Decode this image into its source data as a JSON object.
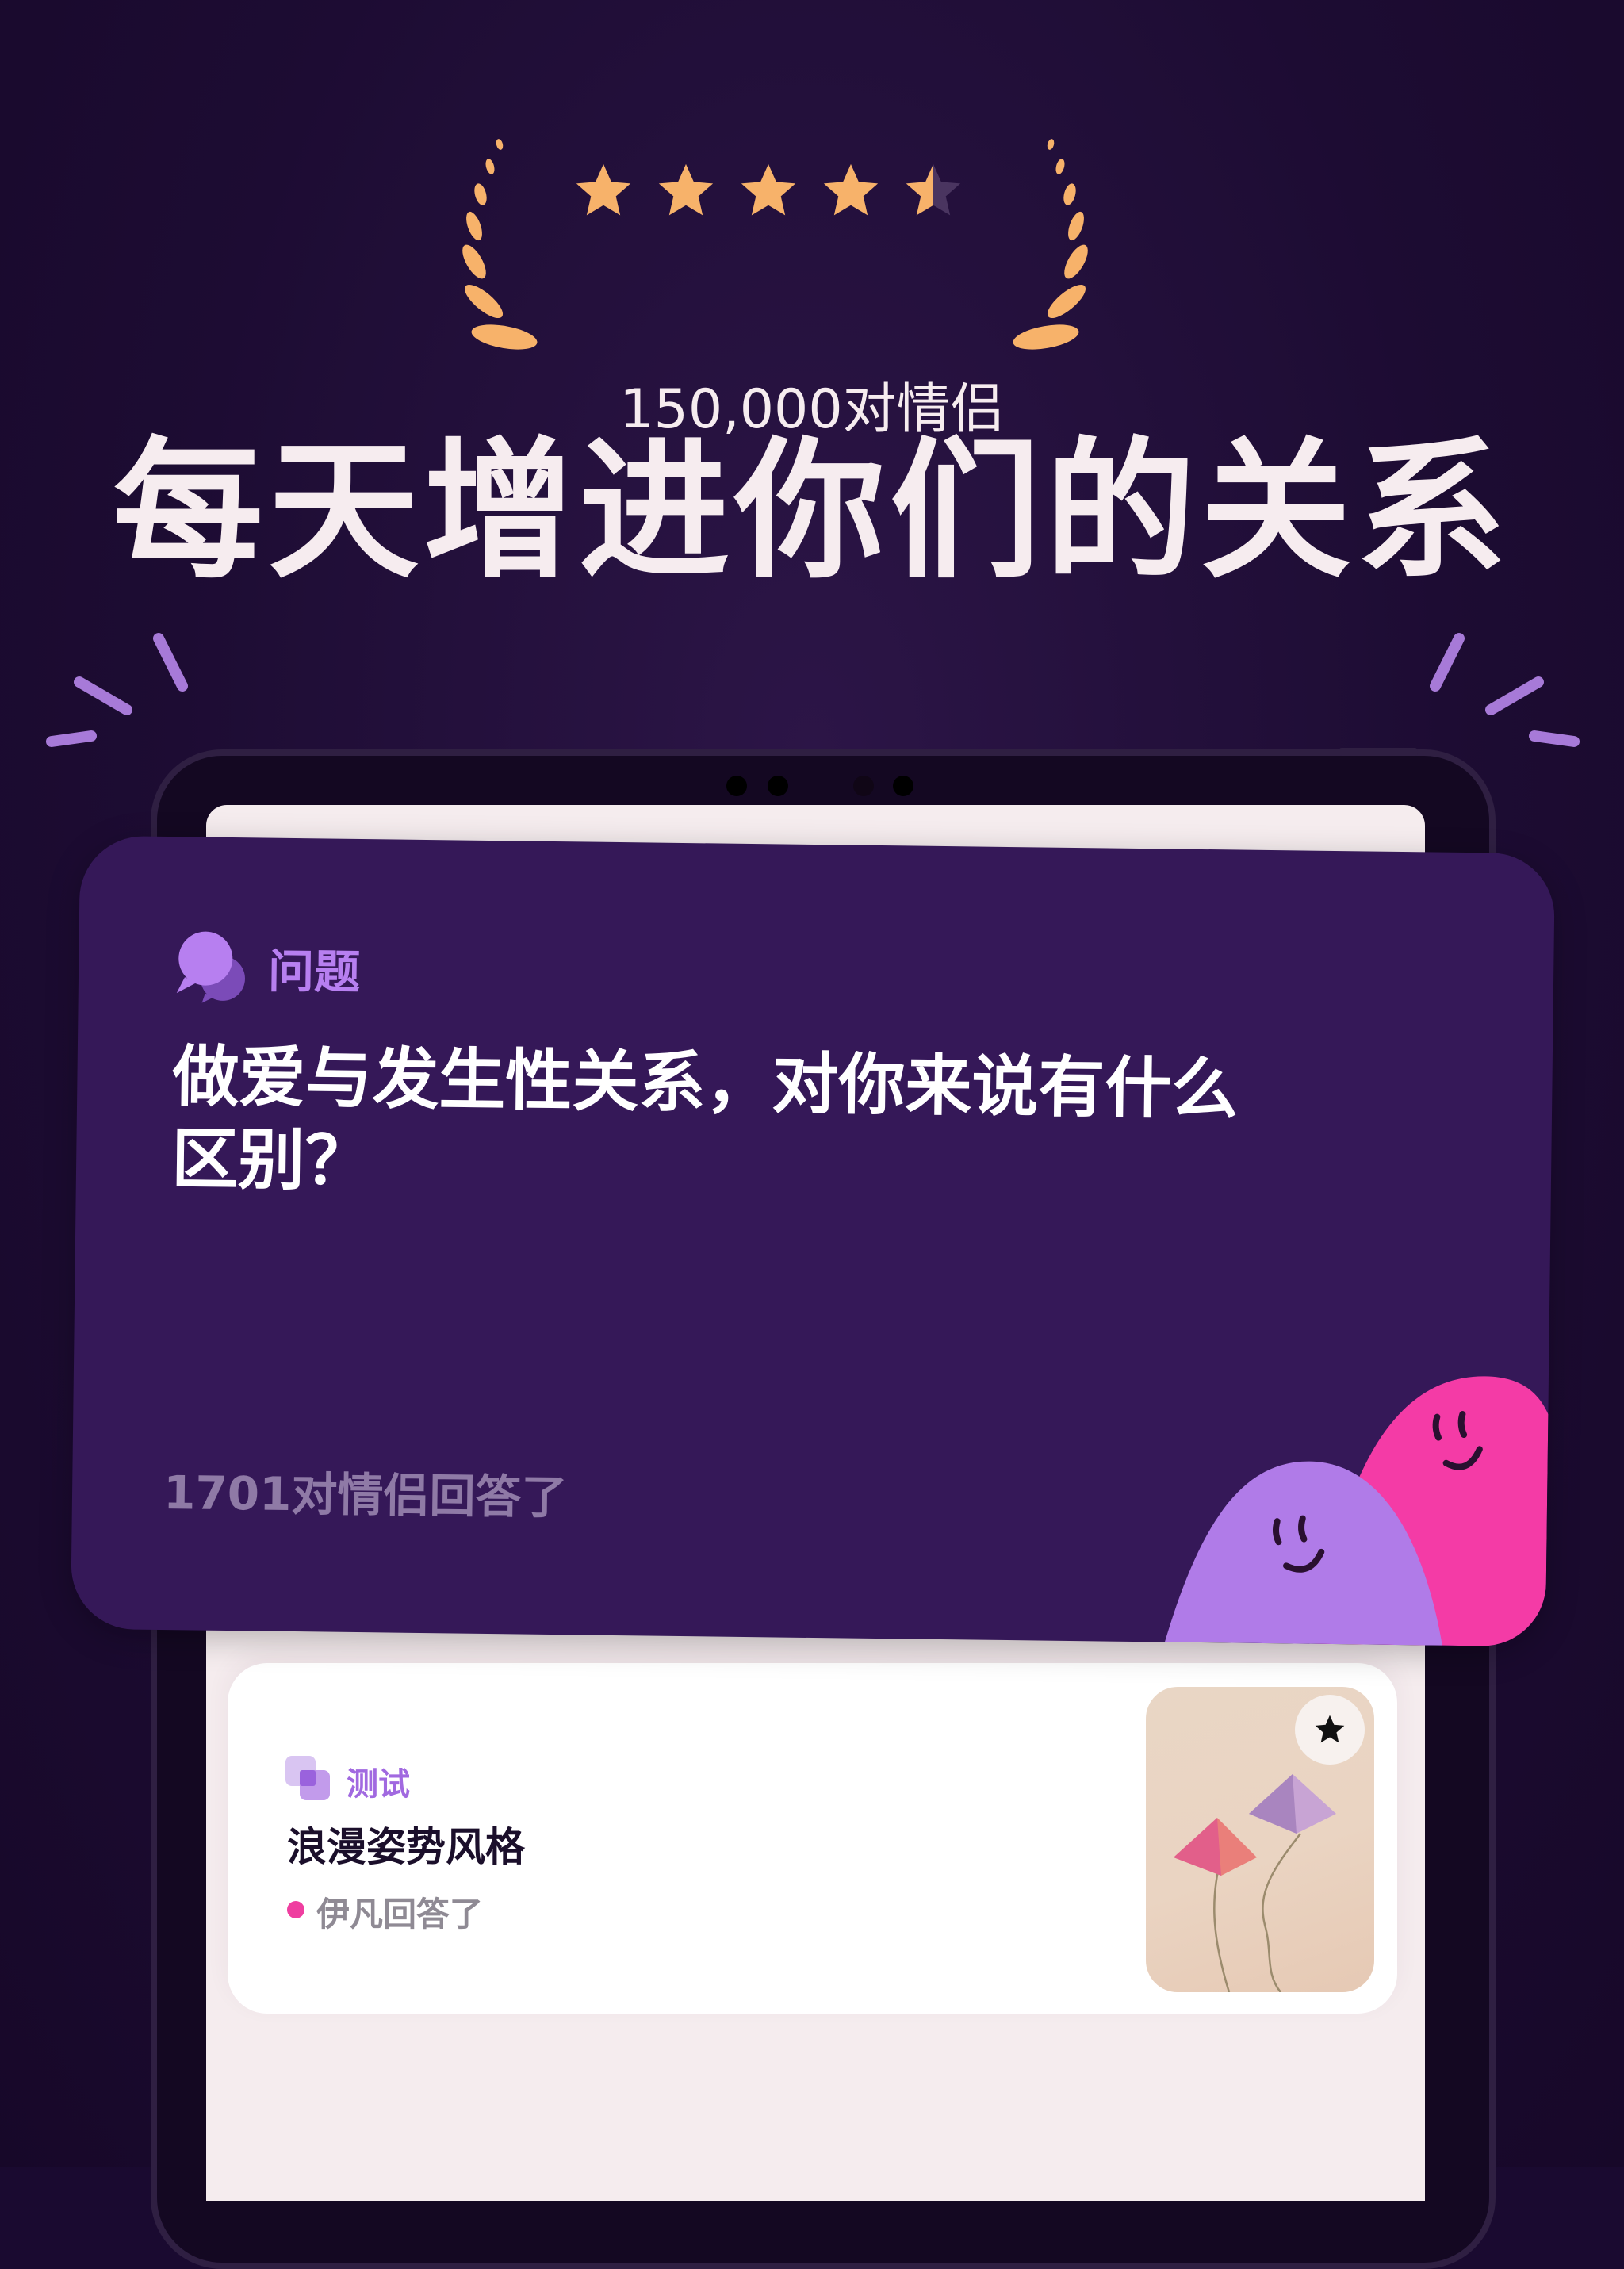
{
  "rating": {
    "stars": 4.5,
    "count_text": "150,000对情侣",
    "star_color": "#f7b26a"
  },
  "headline": "每天增进你们的关系",
  "question_card": {
    "label": "问题",
    "question": "做爱与发生性关系，对你来说有什么区别？",
    "answered_text": "1701对情侣回答了",
    "icon": "chat-bubbles-icon",
    "accent_color": "#b77ff0",
    "background": "#351858"
  },
  "test_card": {
    "label": "测试",
    "title": "浪漫姿势风格",
    "meta": "伊凡回答了",
    "icon": "test-squares-icon",
    "fav_icon": "star-icon",
    "status_dot_color": "#ef3ea0"
  },
  "colors": {
    "background": "#1d0c33",
    "screen": "#f5ecee",
    "pink_blob": "#f43ba6",
    "purple_blob": "#b07be8",
    "spark": "#a77ad8"
  }
}
